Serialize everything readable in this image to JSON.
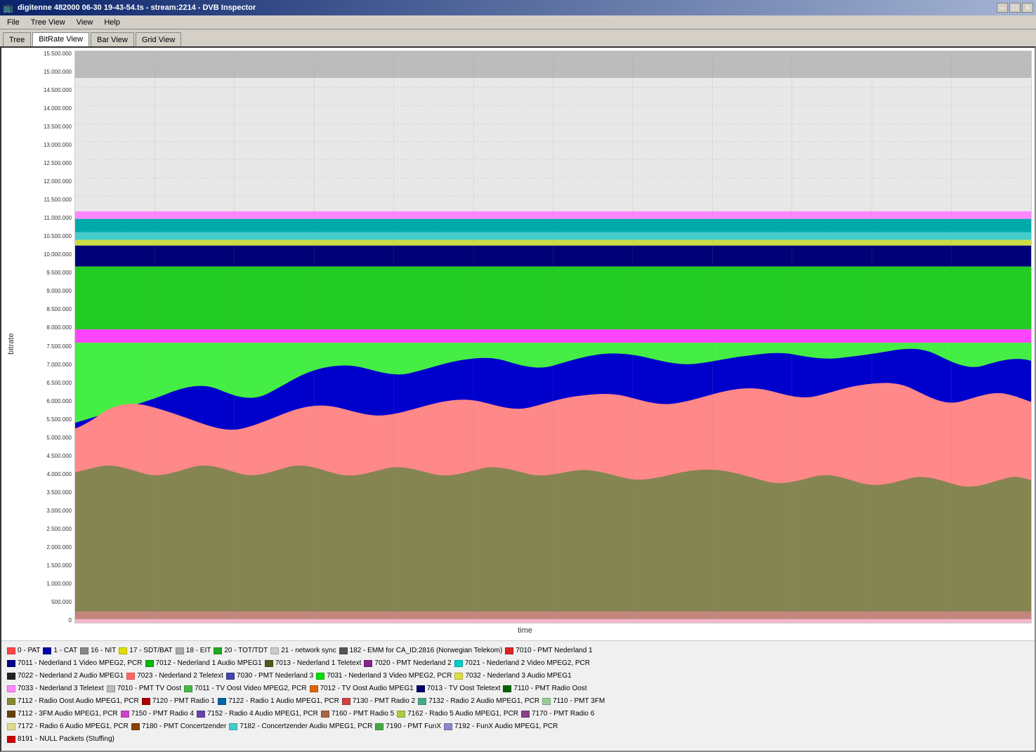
{
  "window": {
    "title": "digitenne 482000 06-30 19-43-54.ts - stream:2214 - DVB Inspector",
    "minimize": "─",
    "maximize": "□",
    "close": "✕"
  },
  "menu": {
    "items": [
      "File",
      "Tree View",
      "View",
      "Help"
    ]
  },
  "tabs": [
    {
      "label": "Tree",
      "active": false
    },
    {
      "label": "BitRate View",
      "active": true
    },
    {
      "label": "Bar View",
      "active": false
    },
    {
      "label": "Grid View",
      "active": false
    }
  ],
  "chart": {
    "y_axis_label": "bitrate",
    "x_axis_label": "time",
    "y_ticks": [
      "15.500.000",
      "15.000.000",
      "14.500.000",
      "14.000.000",
      "13.500.000",
      "13.000.000",
      "12.500.000",
      "12.000.000",
      "11.500.000",
      "11.000.000",
      "10.500.000",
      "10.000.000",
      "9.500.000",
      "9.000.000",
      "8.500.000",
      "8.000.000",
      "7.500.000",
      "7.000.000",
      "6.500.000",
      "6.000.000",
      "5.500.000",
      "5.000.000",
      "4.500.000",
      "4.000.000",
      "3.500.000",
      "3.000.000",
      "2.500.000",
      "2.000.000",
      "1.500.000",
      "1.000.000",
      "500.000",
      "0"
    ]
  },
  "legend": {
    "rows": [
      [
        {
          "color": "#ff4444",
          "label": "0 - PAT"
        },
        {
          "color": "#0000aa",
          "label": "1 - CAT"
        },
        {
          "color": "#888888",
          "label": "16 - NIT"
        },
        {
          "color": "#dddd00",
          "label": "17 - SDT/BAT"
        },
        {
          "color": "#aaaaaa",
          "label": "18 - EIT"
        },
        {
          "color": "#22aa22",
          "label": "20 - TOT/TDT"
        },
        {
          "color": "#cccccc",
          "label": "21 - network sync"
        },
        {
          "color": "#555555",
          "label": "182 - EMM for CA_ID:2816 (Norwegian Telekom)"
        },
        {
          "color": "#dd2222",
          "label": "7010 - PMT Nederland 1"
        }
      ],
      [
        {
          "color": "#000088",
          "label": "7011 - Nederland 1 Video MPEG2, PCR"
        },
        {
          "color": "#00bb00",
          "label": "7012 - Nederland 1 Audio MPEG1"
        },
        {
          "color": "#555522",
          "label": "7013 - Nederland 1 Teletext"
        },
        {
          "color": "#882288",
          "label": "7020 - PMT Nederland 2"
        },
        {
          "color": "#00cccc",
          "label": "7021 - Nederland 2 Video MPEG2, PCR"
        }
      ],
      [
        {
          "color": "#222222",
          "label": "7022 - Nederland 2 Audio MPEG1"
        },
        {
          "color": "#ff6666",
          "label": "7023 - Nederland 2 Teletext"
        },
        {
          "color": "#4444aa",
          "label": "7030 - PMT Nederland 3"
        },
        {
          "color": "#00dd00",
          "label": "7031 - Nederland 3 Video MPEG2, PCR"
        },
        {
          "color": "#dddd44",
          "label": "7032 - Nederland 3 Audio MPEG1"
        }
      ],
      [
        {
          "color": "#ff88ff",
          "label": "7033 - Nederland 3 Teletext"
        },
        {
          "color": "#bbbbbb",
          "label": "7010 - PMT TV Oost"
        },
        {
          "color": "#44bb44",
          "label": "7011 - TV Oost Video MPEG2, PCR"
        },
        {
          "color": "#dd6600",
          "label": "7012 - TV Oost Audio MPEG1"
        },
        {
          "color": "#000066",
          "label": "7013 - TV Oost Teletext"
        },
        {
          "color": "#006600",
          "label": "7110 - PMT Radio Oost"
        }
      ],
      [
        {
          "color": "#888833",
          "label": "7112 - Radio Oost Audio MPEG1, PCR"
        },
        {
          "color": "#aa0000",
          "label": "7120 - PMT Radio 1"
        },
        {
          "color": "#0066aa",
          "label": "7122 - Radio 1 Audio MPEG1, PCR"
        },
        {
          "color": "#cc4444",
          "label": "7130 - PMT Radio 2"
        },
        {
          "color": "#44aa88",
          "label": "7132 - Radio 2 Audio MPEG1, PCR"
        },
        {
          "color": "#99cc99",
          "label": "7110 - PMT 3FM"
        }
      ],
      [
        {
          "color": "#664400",
          "label": "7112 - 3FM Audio MPEG1, PCR"
        },
        {
          "color": "#cc44cc",
          "label": "7150 - PMT Radio 4"
        },
        {
          "color": "#6644aa",
          "label": "7152 - Radio 4 Audio MPEG1, PCR"
        },
        {
          "color": "#aa6644",
          "label": "7160 - PMT Radio 5"
        },
        {
          "color": "#aacc44",
          "label": "7162 - Radio 5 Audio MPEG1, PCR"
        },
        {
          "color": "#884488",
          "label": "7170 - PMT Radio 6"
        }
      ],
      [
        {
          "color": "#dddd88",
          "label": "7172 - Radio 6 Audio MPEG1, PCR"
        },
        {
          "color": "#884400",
          "label": "7180 - PMT Concertzender"
        },
        {
          "color": "#44cccc",
          "label": "7182 - Concertzender Audio MPEG1, PCR"
        },
        {
          "color": "#44aa44",
          "label": "7190 - PMT FunX"
        },
        {
          "color": "#8888cc",
          "label": "7192 - FunX Audio MPEG1, PCR"
        }
      ],
      [
        {
          "color": "#cc0000",
          "label": "8191 - NULL Packets (Stuffing)"
        }
      ]
    ]
  }
}
